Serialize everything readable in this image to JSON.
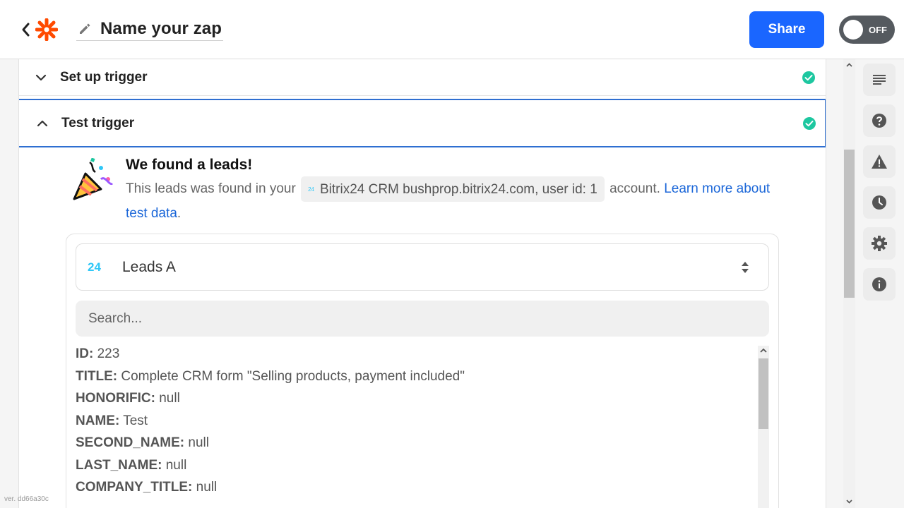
{
  "header": {
    "zap_name": "Name your zap",
    "share_label": "Share",
    "toggle_label": "OFF"
  },
  "steps": [
    {
      "title": "Set up trigger",
      "status": "complete"
    },
    {
      "title": "Test trigger",
      "status": "complete"
    }
  ],
  "found": {
    "title": "We found a leads!",
    "text_before": "This leads was found in your",
    "account_chip_icon": "24",
    "account_chip": "Bitrix24 CRM bushprop.bitrix24.com, user id: 1",
    "text_after": "account.",
    "link_text_1": "Learn more about",
    "link_text_2": "test data",
    "period": "."
  },
  "selector": {
    "app_icon": "24",
    "value": "Leads A"
  },
  "search": {
    "placeholder": "Search..."
  },
  "fields": [
    {
      "key": "ID:",
      "value": "223"
    },
    {
      "key": "TITLE:",
      "value": "Complete CRM form \"Selling products, payment included\""
    },
    {
      "key": "HONORIFIC:",
      "value": "null"
    },
    {
      "key": "NAME:",
      "value": "Test"
    },
    {
      "key": "SECOND_NAME:",
      "value": "null"
    },
    {
      "key": "LAST_NAME:",
      "value": "null"
    },
    {
      "key": "COMPANY_TITLE:",
      "value": "null"
    },
    {
      "key": "",
      "value": ""
    }
  ],
  "sidebar_icons": [
    "notes-icon",
    "help-icon",
    "alert-icon",
    "history-icon",
    "settings-icon",
    "info-icon"
  ],
  "version": "ver. dd66a30c",
  "colors": {
    "accent": "#1a66ff",
    "success": "#1dc7a0",
    "link": "#1a66d8",
    "bitrix": "#2fc7f7"
  }
}
